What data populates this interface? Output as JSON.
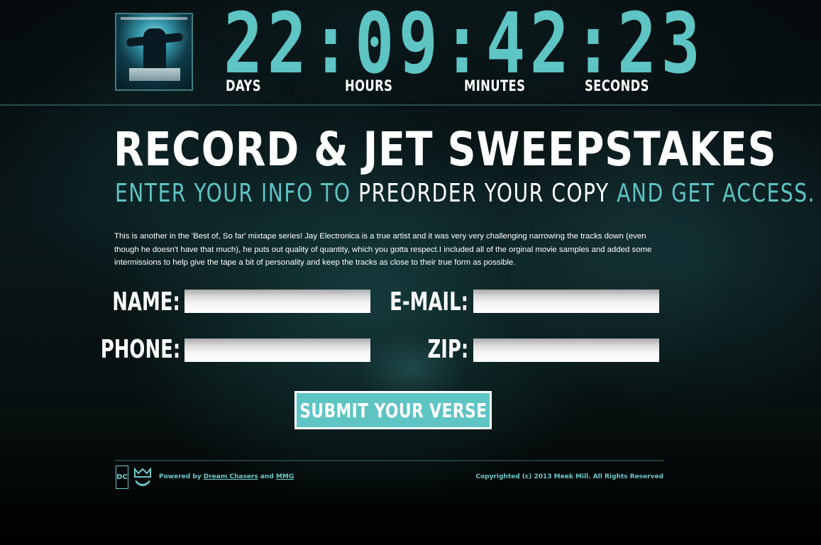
{
  "countdown": {
    "digits": "22:09:42:23",
    "labels": {
      "days": "DAYS",
      "hours": "HOURS",
      "minutes": "MINUTES",
      "seconds": "SECONDS"
    }
  },
  "hero": {
    "title": "RECORD & JET SWEEPSTAKES",
    "subtitle_part1": "ENTER YOUR INFO TO ",
    "subtitle_part2": "PREORDER YOUR COPY",
    "subtitle_part3": " AND GET ACCESS.",
    "description": "This is another in the 'Best of, So far' mixtape series! Jay Electronica is a true artist and it was very very challenging narrowing the tracks down (even though he doesn't have that much), he puts out quality of quantity, which you gotta respect.I included all of the orginal movie samples and added some intermissions to help give the tape a bit of personality and keep the tracks as close to their true form as possible."
  },
  "form": {
    "name_label": "NAME:",
    "email_label": "E-MAIL:",
    "phone_label": "PHONE:",
    "zip_label": "ZIP:",
    "name_value": "",
    "email_value": "",
    "phone_value": "",
    "zip_value": "",
    "submit_label": "SUBMIT YOUR VERSE"
  },
  "footer": {
    "dc_logo_text": "DC",
    "powered_prefix": "Powered by ",
    "link_dream_chasers": "Dream Chasers",
    "and_text": " and ",
    "link_mmg": "MMG",
    "copyright": "Copyrighted (c) 2013 Meek Mill. All Rights Reserved"
  },
  "colors": {
    "accent": "#5ec4c4",
    "background": "#000000",
    "text": "#ffffff"
  },
  "icons": {
    "dc_logo": "dream-chasers-logo-icon",
    "mmg_logo": "mmg-logo-icon"
  }
}
